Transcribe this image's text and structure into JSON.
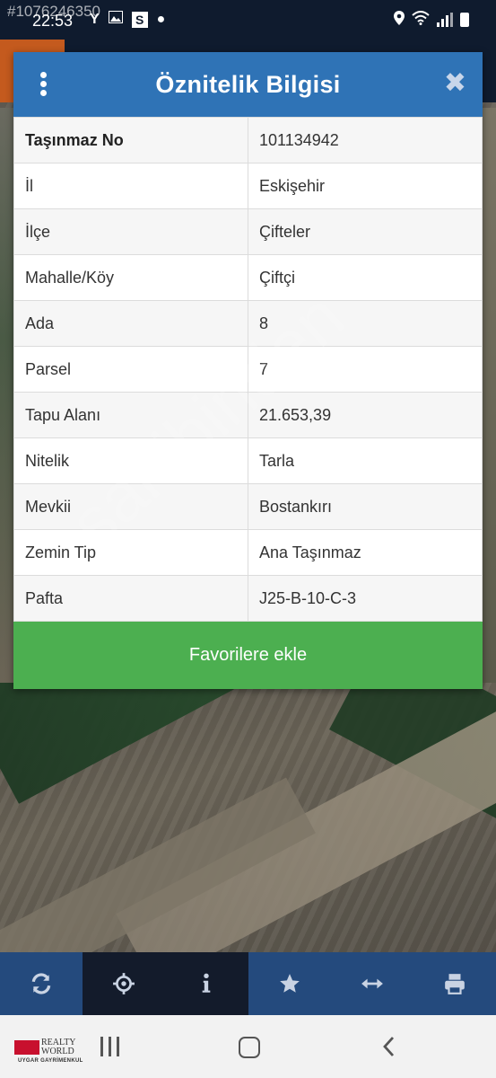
{
  "status_bar": {
    "watermark_id": "#1076246350",
    "time": "22:53",
    "left_icons": [
      "Y-icon",
      "image-icon",
      "s-icon",
      "dot-icon"
    ],
    "s_icon_letter": "S",
    "right_icons": [
      "location-icon",
      "wifi-icon",
      "signal-icon",
      "battery-icon"
    ]
  },
  "dialog": {
    "title": "Öznitelik Bilgisi",
    "close_label": "✖",
    "rows": [
      {
        "key": "Taşınmaz No",
        "value": "101134942"
      },
      {
        "key": "İl",
        "value": "Eskişehir"
      },
      {
        "key": "İlçe",
        "value": "Çifteler"
      },
      {
        "key": "Mahalle/Köy",
        "value": "Çiftçi"
      },
      {
        "key": "Ada",
        "value": "8"
      },
      {
        "key": "Parsel",
        "value": "7"
      },
      {
        "key": "Tapu Alanı",
        "value": "21.653,39"
      },
      {
        "key": "Nitelik",
        "value": "Tarla"
      },
      {
        "key": "Mevkii",
        "value": "Bostankırı"
      },
      {
        "key": "Zemin Tip",
        "value": "Ana Taşınmaz"
      },
      {
        "key": "Pafta",
        "value": "J25-B-10-C-3"
      }
    ],
    "favorite_button": "Favorilere ekle"
  },
  "watermark_text": "sahibinden",
  "toolbar": {
    "buttons": [
      "refresh-icon",
      "crosshair-icon",
      "info-icon",
      "star-icon",
      "measure-icon",
      "print-icon"
    ]
  },
  "navbar": {
    "logo_line1": "REALTY",
    "logo_line2": "WORLD",
    "logo_sub": "UYGAR GAYRİMENKUL"
  },
  "colors": {
    "header_blue": "#2f73b6",
    "favorite_green": "#4caf50",
    "toolbar_navy": "#0f1b2e",
    "accent_orange": "#c45a1e"
  }
}
